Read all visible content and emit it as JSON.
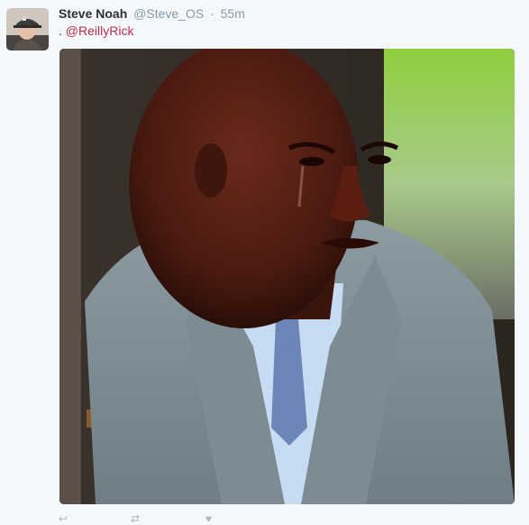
{
  "tweet": {
    "author_name": "Steve Noah",
    "author_handle": "@Steve_OS",
    "separator": "·",
    "time": "55m",
    "text_prefix": ".",
    "mention": "@ReillyRick"
  },
  "colors": {
    "name": "#292f33",
    "meta": "#8899a6",
    "mention": "#b5314b",
    "background": "#f5f8fa"
  },
  "icons": {
    "reply": "reply-icon",
    "retweet": "retweet-icon",
    "like": "heart-icon"
  }
}
